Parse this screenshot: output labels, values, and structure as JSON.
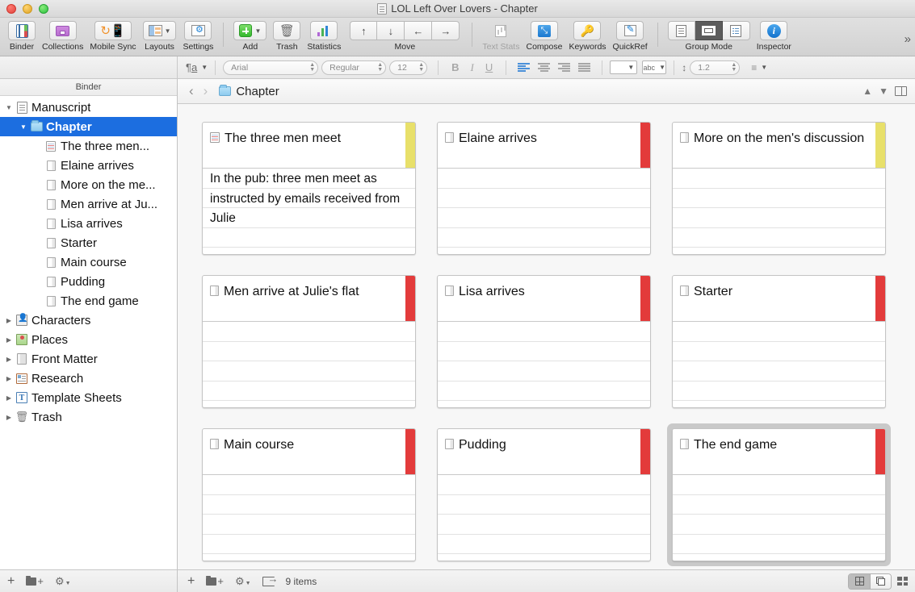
{
  "window": {
    "title": "LOL Left Over Lovers - Chapter",
    "title_icon": "document-icon",
    "traffic_lights": [
      "close",
      "minimize",
      "zoom"
    ]
  },
  "toolbar": {
    "items": [
      {
        "label": "Binder",
        "icon": "binder-icon",
        "has_menu": false
      },
      {
        "label": "Collections",
        "icon": "collections-icon",
        "has_menu": false
      },
      {
        "label": "Mobile Sync",
        "icon": "sync-icon",
        "has_menu": false
      },
      {
        "label": "Layouts",
        "icon": "layouts-icon",
        "has_menu": true
      },
      {
        "label": "Settings",
        "icon": "settings-icon",
        "has_menu": false
      },
      {
        "label": "Add",
        "icon": "add-icon",
        "has_menu": true
      },
      {
        "label": "Trash",
        "icon": "trash-icon",
        "has_menu": false
      },
      {
        "label": "Statistics",
        "icon": "statistics-icon",
        "has_menu": false
      },
      {
        "label": "Move",
        "icon": "move-arrows",
        "has_menu": false
      },
      {
        "label": "Text Stats",
        "icon": "text-stats-icon",
        "has_menu": false,
        "disabled": true
      },
      {
        "label": "Compose",
        "icon": "compose-icon",
        "has_menu": false
      },
      {
        "label": "Keywords",
        "icon": "keywords-icon",
        "has_menu": false
      },
      {
        "label": "QuickRef",
        "icon": "quickref-icon",
        "has_menu": false
      },
      {
        "label": "Group Mode",
        "icon": "group-mode-icons",
        "has_menu": false
      },
      {
        "label": "Inspector",
        "icon": "inspector-icon",
        "has_menu": false
      }
    ],
    "move_arrows": [
      "↑",
      "↓",
      "←",
      "→"
    ],
    "group_mode_selected_index": 1,
    "overflow": "»"
  },
  "format_bar": {
    "paragraph_style_icon": "paragraph-style-icon",
    "font_family": "Arial",
    "font_style": "Regular",
    "font_size": "12",
    "bold": "B",
    "italic": "I",
    "underline": "U",
    "alignment_selected": "left",
    "color_well_label": "",
    "highlight_label": "abc",
    "line_spacing": "1.2",
    "line_spacing_icon": "line-height-icon",
    "list_icon": "list-icon"
  },
  "binder": {
    "header": "Binder",
    "items": [
      {
        "label": "Manuscript",
        "icon": "manuscript-icon",
        "indent": 0,
        "disclosure": "open",
        "selected": false
      },
      {
        "label": "Chapter",
        "icon": "folder-icon",
        "indent": 1,
        "disclosure": "open",
        "selected": true
      },
      {
        "label": "The three men...",
        "icon": "text-document-icon",
        "indent": 2,
        "disclosure": "none",
        "selected": false
      },
      {
        "label": "Elaine arrives",
        "icon": "blank-document-icon",
        "indent": 2,
        "disclosure": "none",
        "selected": false
      },
      {
        "label": "More on the me...",
        "icon": "blank-document-icon",
        "indent": 2,
        "disclosure": "none",
        "selected": false
      },
      {
        "label": "Men arrive at Ju...",
        "icon": "blank-document-icon",
        "indent": 2,
        "disclosure": "none",
        "selected": false
      },
      {
        "label": "Lisa arrives",
        "icon": "blank-document-icon",
        "indent": 2,
        "disclosure": "none",
        "selected": false
      },
      {
        "label": "Starter",
        "icon": "blank-document-icon",
        "indent": 2,
        "disclosure": "none",
        "selected": false
      },
      {
        "label": "Main course",
        "icon": "blank-document-icon",
        "indent": 2,
        "disclosure": "none",
        "selected": false
      },
      {
        "label": "Pudding",
        "icon": "blank-document-icon",
        "indent": 2,
        "disclosure": "none",
        "selected": false
      },
      {
        "label": "The end game",
        "icon": "blank-document-icon",
        "indent": 2,
        "disclosure": "none",
        "selected": false
      },
      {
        "label": "Characters",
        "icon": "characters-icon",
        "indent": 0,
        "disclosure": "closed",
        "selected": false
      },
      {
        "label": "Places",
        "icon": "places-icon",
        "indent": 0,
        "disclosure": "closed",
        "selected": false
      },
      {
        "label": "Front Matter",
        "icon": "front-matter-icon",
        "indent": 0,
        "disclosure": "closed",
        "selected": false
      },
      {
        "label": "Research",
        "icon": "research-icon",
        "indent": 0,
        "disclosure": "closed",
        "selected": false
      },
      {
        "label": "Template Sheets",
        "icon": "template-sheets-icon",
        "indent": 0,
        "disclosure": "closed",
        "selected": false
      },
      {
        "label": "Trash",
        "icon": "trash-bin-icon",
        "indent": 0,
        "disclosure": "closed",
        "selected": false
      }
    ]
  },
  "breadcrumb": {
    "back_icon": "chevron-left-icon",
    "forward_icon": "chevron-right-icon",
    "folder_icon": "folder-icon",
    "title": "Chapter",
    "up_icon": "chevron-up-icon",
    "down_icon": "chevron-down-icon",
    "split_icon": "split-view-icon"
  },
  "corkboard": {
    "cards": [
      {
        "title": "The three men meet",
        "synopsis": "In the pub: three men meet as instructed by emails received from Julie",
        "stripe": "#e8e06a",
        "icon": "text-document-icon",
        "selected": false
      },
      {
        "title": "Elaine arrives",
        "synopsis": "",
        "stripe": "#e33b3b",
        "icon": "blank-document-icon",
        "selected": false
      },
      {
        "title": "More on the men's discussion",
        "synopsis": "",
        "stripe": "#e8e06a",
        "icon": "blank-document-icon",
        "selected": false
      },
      {
        "title": "Men arrive at Julie's flat",
        "synopsis": "",
        "stripe": "#e33b3b",
        "icon": "blank-document-icon",
        "selected": false
      },
      {
        "title": "Lisa arrives",
        "synopsis": "",
        "stripe": "#e33b3b",
        "icon": "blank-document-icon",
        "selected": false
      },
      {
        "title": "Starter",
        "synopsis": "",
        "stripe": "#e33b3b",
        "icon": "blank-document-icon",
        "selected": false
      },
      {
        "title": "Main course",
        "synopsis": "",
        "stripe": "#e33b3b",
        "icon": "blank-document-icon",
        "selected": false
      },
      {
        "title": "Pudding",
        "synopsis": "",
        "stripe": "#e33b3b",
        "icon": "blank-document-icon",
        "selected": false
      },
      {
        "title": "The end game",
        "synopsis": "",
        "stripe": "#e33b3b",
        "icon": "blank-document-icon",
        "selected": true
      }
    ]
  },
  "footer": {
    "left_buttons": [
      "add-icon",
      "add-folder-icon",
      "settings-gear-icon"
    ],
    "right_buttons": [
      "add-icon",
      "add-folder-icon",
      "settings-gear-icon",
      "export-icon"
    ],
    "item_count": "9 items",
    "view_modes": [
      {
        "icon": "corkboard-grid-icon",
        "active": true
      },
      {
        "icon": "corkboard-freeform-icon",
        "active": false
      }
    ],
    "tiles_icon": "tiles-icon"
  },
  "colors": {
    "selection_blue": "#1c6ee0",
    "status_red": "#e33b3b",
    "status_yellow": "#e8e06a",
    "corkboard_bg": "#f7f7f7"
  }
}
